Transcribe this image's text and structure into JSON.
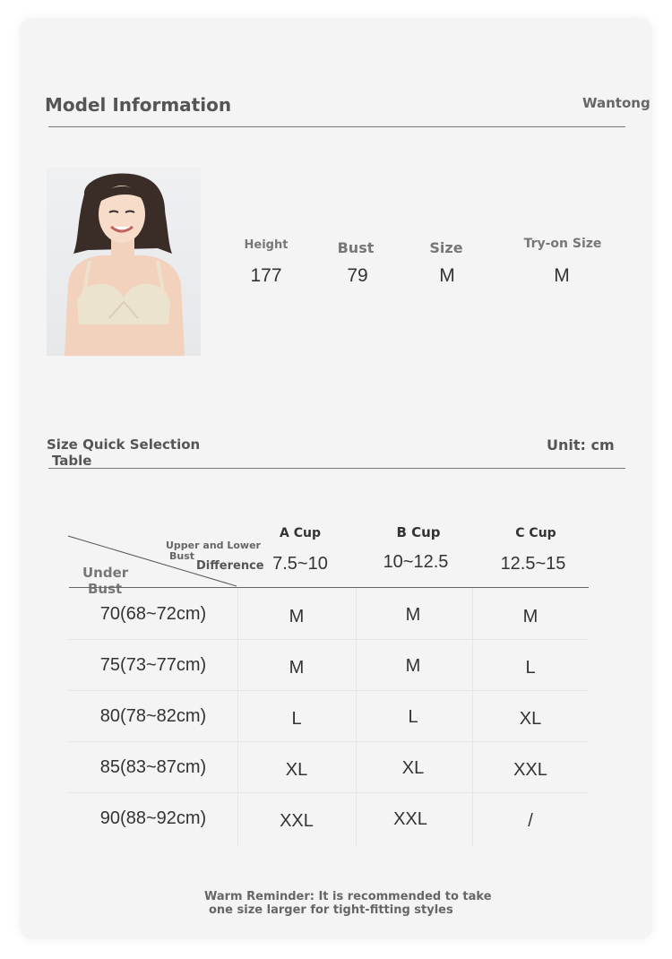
{
  "model": {
    "title": "Model Information",
    "brand": "Wantong",
    "stats": [
      {
        "label": "Height",
        "value": "177"
      },
      {
        "label": "Bust",
        "value": "79"
      },
      {
        "label": "Size",
        "value": "M"
      },
      {
        "label": "Try-on Size",
        "value": "M"
      }
    ]
  },
  "size_table": {
    "title_line1": "Size Quick Selection",
    "title_line2": "Table",
    "unit": "Unit: cm",
    "corner_top_line1": "Upper and Lower",
    "corner_top_line2": "Bust",
    "corner_top_line3": "Difference",
    "corner_bottom_line1": "Under",
    "corner_bottom_line2": "Bust",
    "columns": [
      {
        "cup": "A Cup",
        "range": "7.5~10"
      },
      {
        "cup": "B Cup",
        "range": "10~12.5"
      },
      {
        "cup": "C Cup",
        "range": "12.5~15"
      }
    ],
    "rows": [
      {
        "label": "70(68~72cm)",
        "cells": [
          "M",
          "M",
          "M"
        ]
      },
      {
        "label": "75(73~77cm)",
        "cells": [
          "M",
          "M",
          "L"
        ]
      },
      {
        "label": "80(78~82cm)",
        "cells": [
          "L",
          "L",
          "XL"
        ]
      },
      {
        "label": "85(83~87cm)",
        "cells": [
          "XL",
          "XL",
          "XXL"
        ]
      },
      {
        "label": "90(88~92cm)",
        "cells": [
          "XXL",
          "XXL",
          "/"
        ]
      }
    ]
  },
  "reminder": {
    "line1": "Warm Reminder: It is recommended to take",
    "line2": "one size larger for tight-fitting styles"
  }
}
